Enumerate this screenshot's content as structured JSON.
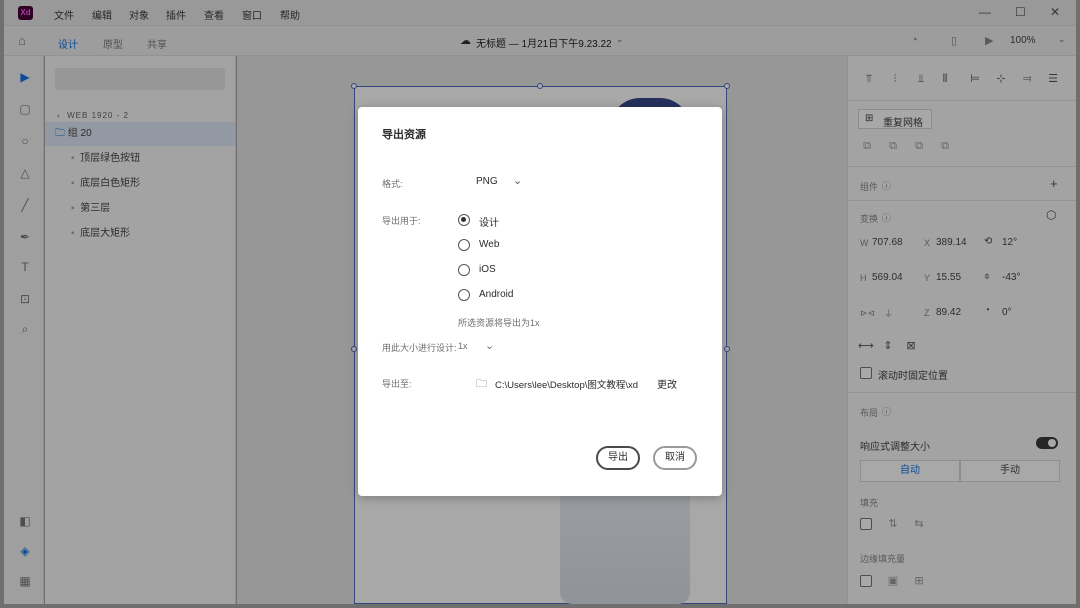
{
  "app": {
    "logo": "Xd",
    "title": "无标题 — 1月21日下午9.23.22",
    "zoom": "100%"
  },
  "menu": [
    "文件",
    "编辑",
    "对象",
    "插件",
    "查看",
    "窗口",
    "帮助"
  ],
  "tabs": [
    "设计",
    "原型",
    "共享"
  ],
  "layers": {
    "artboard": "WEB 1920 - 2",
    "group": "组 20",
    "items": [
      "顶层绿色按钮",
      "底层白色矩形",
      "第三层",
      "底层大矩形"
    ]
  },
  "props": {
    "repeat_grid": "重复网格",
    "component_label": "组件",
    "transform_label": "变换",
    "w_label": "W",
    "w": "707.68",
    "x_label": "X",
    "x": "389.14",
    "rotation": "12°",
    "h_label": "H",
    "h": "569.04",
    "y_label": "Y",
    "y": "15.55",
    "flip_angle": "-43°",
    "z_label": "Z",
    "z": "89.42",
    "angle3": "0°",
    "fix_position": "滚动时固定位置",
    "layout_label": "布局",
    "responsive": "响应式调整大小",
    "auto": "自动",
    "manual": "手动",
    "padding_label": "填充",
    "stack_label": "边缘填充量"
  },
  "dialog": {
    "title": "导出资源",
    "format_label": "格式:",
    "format_value": "PNG",
    "export_for_label": "导出用于:",
    "options": [
      "设计",
      "Web",
      "iOS",
      "Android"
    ],
    "selected_option": "设计",
    "hint": "所选资源将导出为1x",
    "design_size_label": "用此大小进行设计:",
    "design_size_value": "1x",
    "export_to_label": "导出至:",
    "path": "C:\\Users\\lee\\Desktop\\图文教程\\xd",
    "change": "更改",
    "export_button": "导出",
    "cancel_button": "取消"
  }
}
